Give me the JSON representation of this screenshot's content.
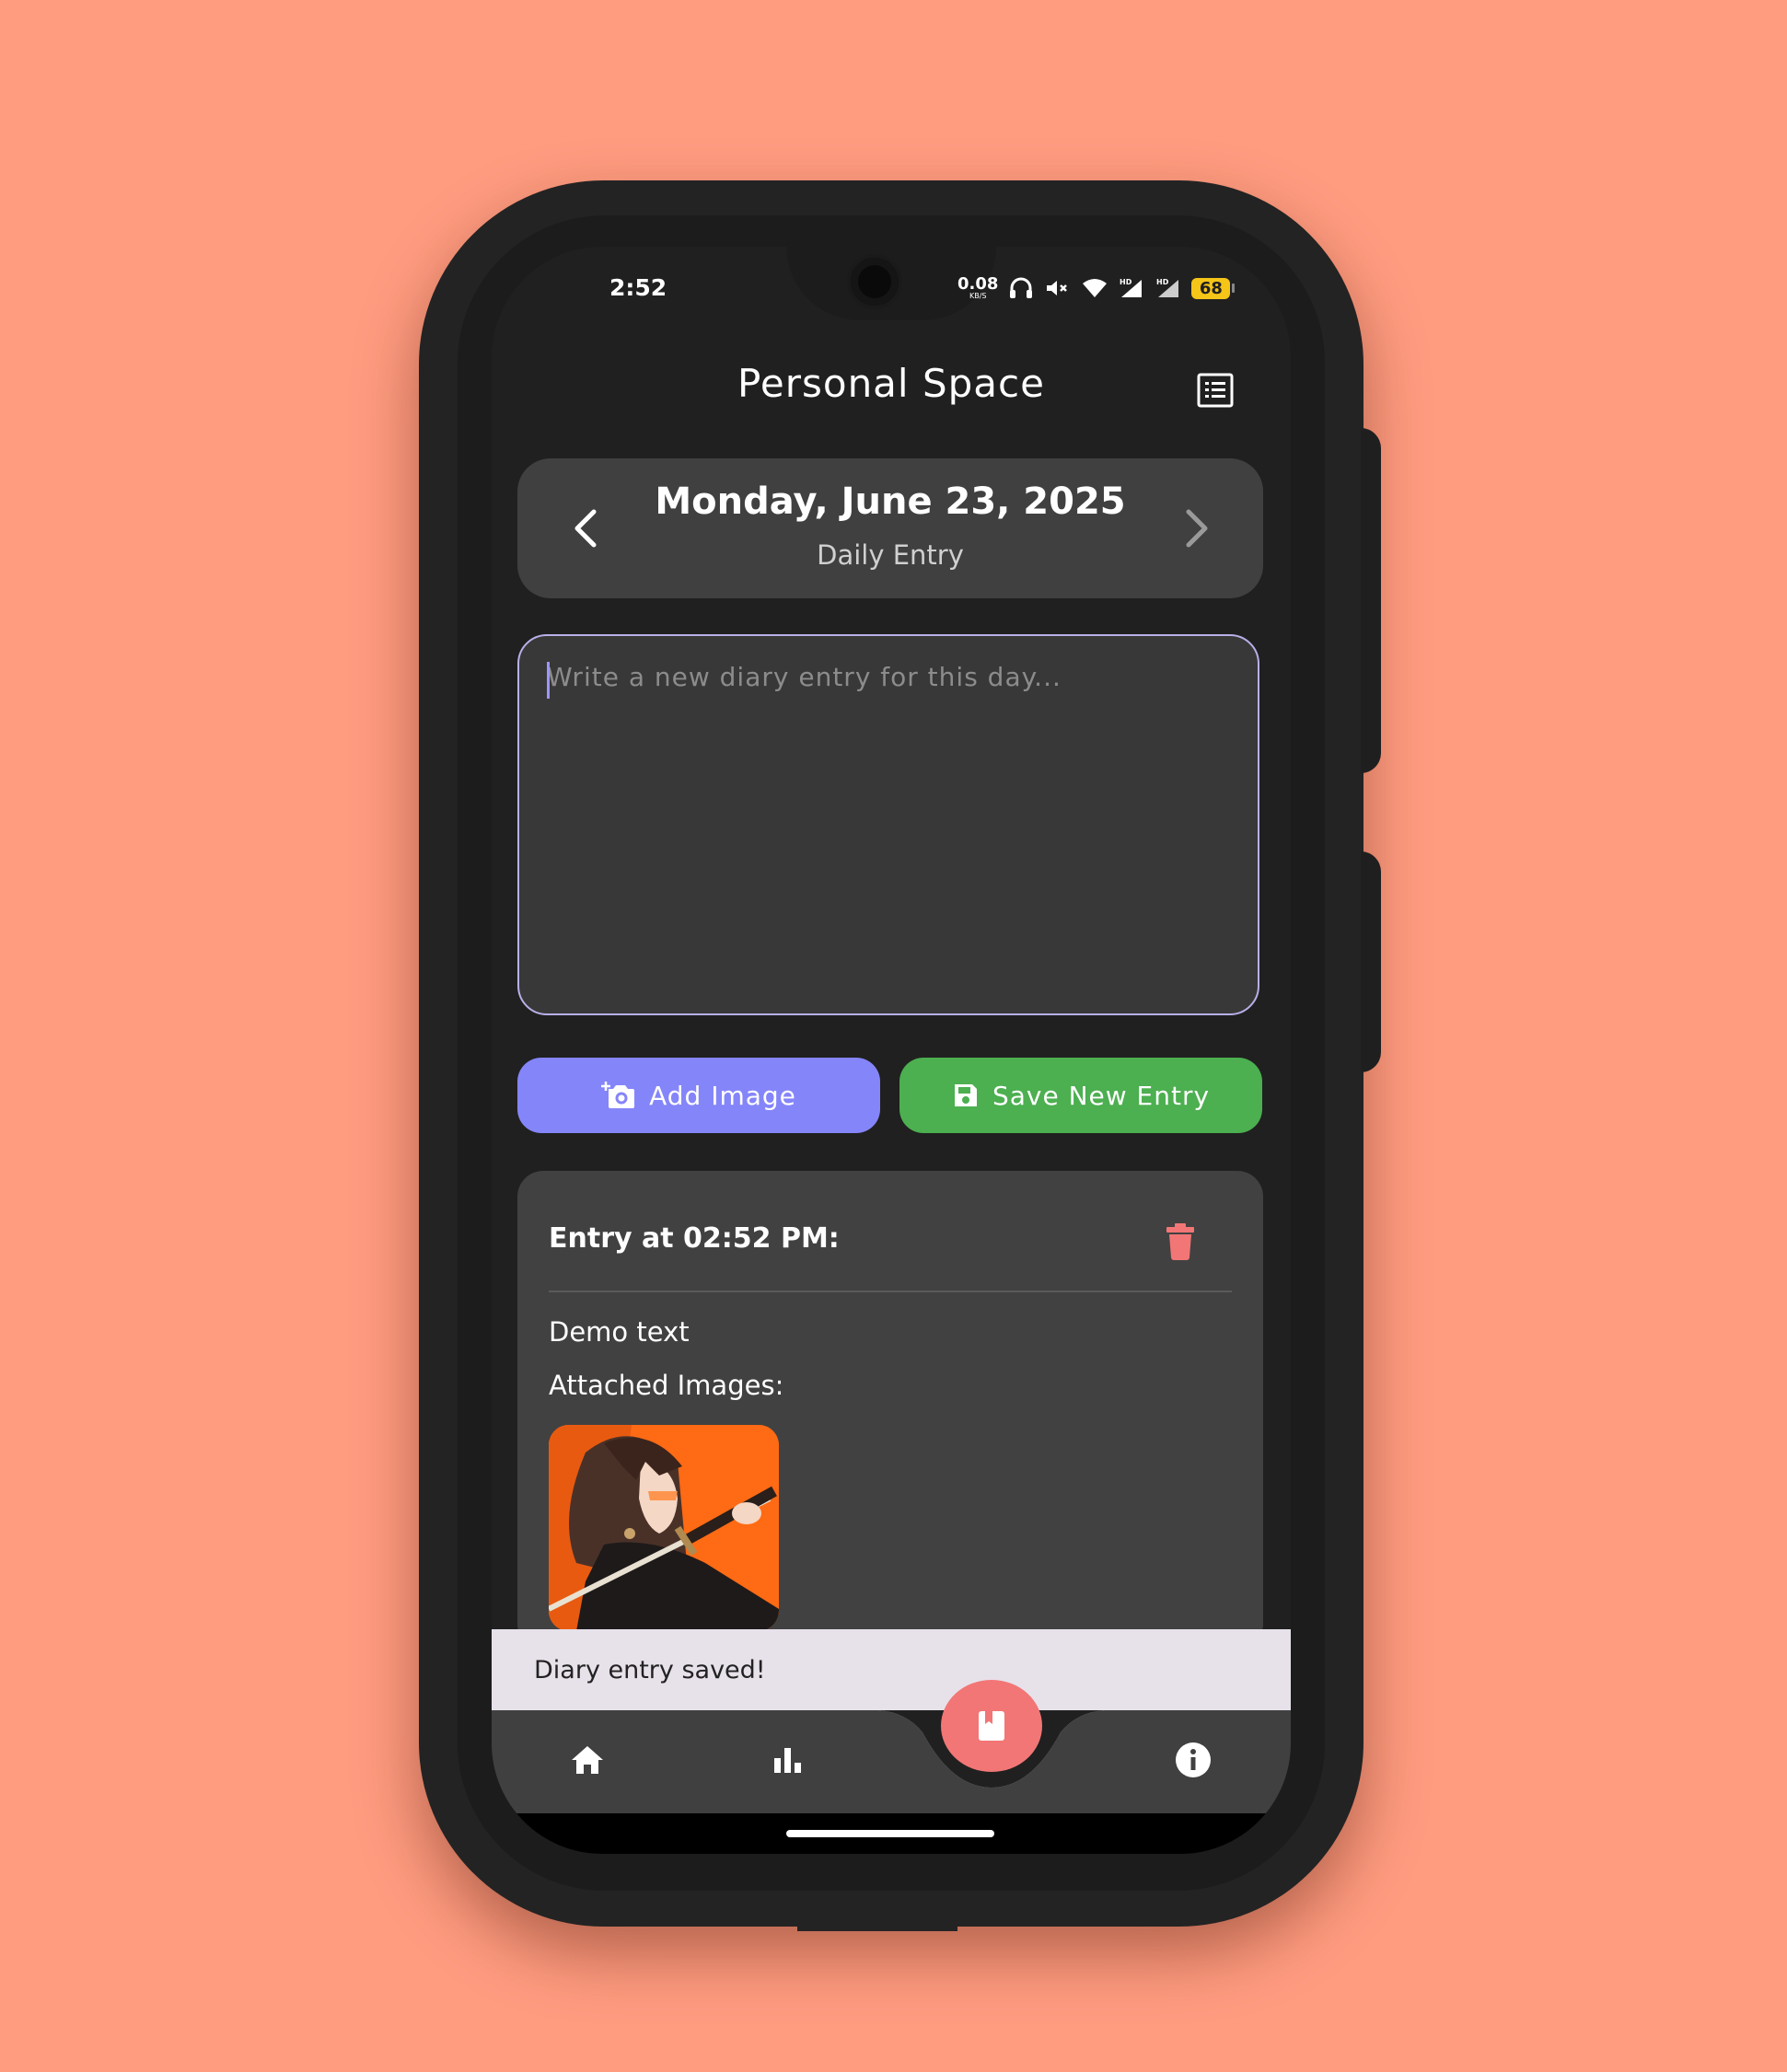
{
  "status_bar": {
    "time": "2:52",
    "net_speed": "0.08",
    "net_unit": "KB/S",
    "battery": "68"
  },
  "header": {
    "title": "Personal Space"
  },
  "date_card": {
    "date": "Monday, June 23, 2025",
    "subtitle": "Daily Entry"
  },
  "editor": {
    "placeholder": "Write a new diary entry for this day...",
    "value": ""
  },
  "actions": {
    "add_image_label": "Add Image",
    "save_label": "Save New Entry"
  },
  "entry": {
    "heading": "Entry at 02:52 PM:",
    "text": "Demo text",
    "attached_label": "Attached Images:"
  },
  "snackbar": {
    "message": "Diary entry saved!"
  },
  "colors": {
    "background": "#FF9C80",
    "add_button": "#8585FA",
    "save_button": "#4CAF50",
    "fab": "#F27676",
    "delete_icon": "#F27676",
    "battery": "#F5C518"
  },
  "icons": {
    "header_action": "list-icon",
    "prev": "chevron-left-icon",
    "next": "chevron-right-icon",
    "add_image": "add-photo-icon",
    "save": "save-icon",
    "delete": "trash-icon",
    "nav": [
      "home-icon",
      "bar-chart-icon",
      "book-icon",
      "info-icon"
    ]
  }
}
